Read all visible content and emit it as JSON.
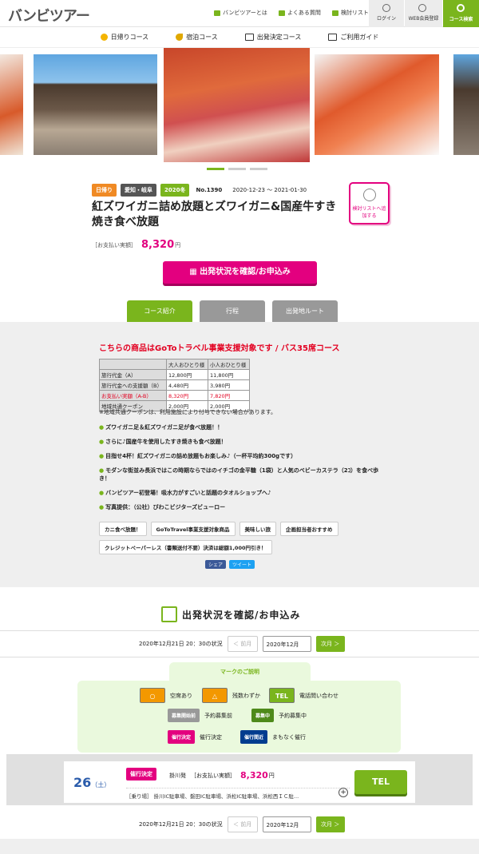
{
  "header": {
    "logo": "バンビツアー",
    "links": [
      "バンビツアーとは",
      "よくある質問",
      "検討リスト"
    ],
    "login": "ログイン",
    "member": "WEB会員登録",
    "search": "コース検索"
  },
  "nav": [
    "日帰りコース",
    "宿泊コース",
    "出発決定コース",
    "ご利用ガイド"
  ],
  "badges": {
    "day": "日帰り",
    "area": "愛知・岐阜",
    "year": "2020冬",
    "no": "No.1390",
    "period": "2020-12-23 ～ 2021-01-30"
  },
  "title": "紅ズワイガニ詰め放題とズワイガニ&国産牛すき焼き食べ放題",
  "price": {
    "label": "［お支払い実額］",
    "value": "8,320",
    "unit": "円"
  },
  "wish": "検討リストへ追加する",
  "apply": "出発状況を確認/お申込み",
  "tabs": [
    "コース紹介",
    "行程",
    "出発地ルート"
  ],
  "panel": {
    "goto": "こちらの商品はGoToトラベル事業支援対象です / バス35席コース",
    "table": {
      "head": [
        "",
        "大人おひとり様",
        "小人おひとり様"
      ],
      "rows": [
        [
          "旅行代金（A）",
          "12,800円",
          "11,800円"
        ],
        [
          "旅行代金への支援額（B）",
          "4,480円",
          "3,980円"
        ],
        [
          "お支払い実額（A-B）",
          "8,320円",
          "7,820円"
        ],
        [
          "地域共通クーポン",
          "2,000円",
          "2,000円"
        ]
      ]
    },
    "note": "※地域共通クーポンは、利用施設により付与できない場合があります。",
    "bullets": [
      "ズワイガニ足＆紅ズワイガニ足が食べ放題！！",
      "さらに♪国産牛を使用したすき焼きも食べ放題！",
      "目指せ4杯！紅ズワイガニの詰め放題もお楽しみ♪（一杯平均約300gです）",
      "モダンな街並み長浜ではこの時期ならではのイチゴの金平糖（1袋）と人気のベビーカステラ（2ｺ）を食べ歩き！",
      "バンビツアー初登場！吸水力がすごいと話題のタオルショップへ♪",
      "写真提供：（公社）びわこビジターズビューロー"
    ],
    "tags": [
      "カニ食べ放題！",
      "GoToTravel事業支援対象商品",
      "美味しい旅",
      "企画担当者おすすめ",
      "クレジットペーパーレス（書類送付不要）決済は総額1,000円引き！"
    ],
    "share": "シェア",
    "tweet": "ツイート"
  },
  "status": {
    "title": "出発状況を確認/お申込み",
    "stamp": "2020年12月21日 20：30の状況",
    "prev": "＜ 前月",
    "month": "2020年12月",
    "next": "次月 ＞"
  },
  "legend": {
    "head": "マークのご説明",
    "items": {
      "avail": "空席あり",
      "few": "残数わずか",
      "tel": "電話問い合わせ",
      "pre_mark": "募集開始前",
      "pre": "予約募集前",
      "open_mark": "募集中",
      "open": "予約募集中",
      "go_mark": "催行決定",
      "go": "催行決定",
      "soon_mark": "催行間近",
      "soon": "まもなく催行"
    },
    "telmark": "TEL"
  },
  "card": {
    "day": "26",
    "dow": "（土）",
    "badge": "催行決定",
    "dep": "掛川発",
    "plabel": "［お支払い実額］",
    "price": "8,320",
    "unit": "円",
    "stops": "［乗り場］ 掛川IC駐車場、磐田IC駐車場、浜松IC駐車場、浜松西ＩＣ駐...",
    "tel": "TEL"
  }
}
